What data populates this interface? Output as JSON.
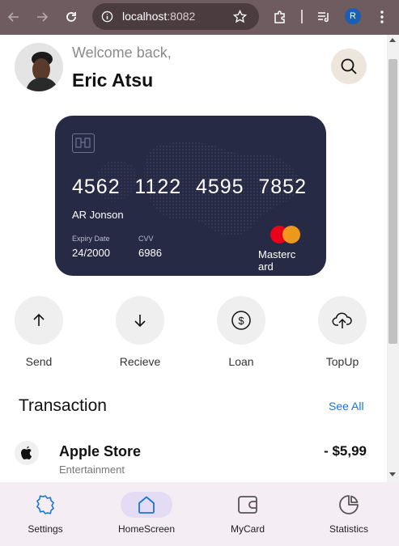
{
  "browser": {
    "url_host": "localhost",
    "url_port": ":8082",
    "profile_initial": "R"
  },
  "header": {
    "welcome": "Welcome back,",
    "user_name": "Eric Atsu"
  },
  "card": {
    "number_groups": [
      "4562",
      "1122",
      "4595",
      "7852"
    ],
    "holder": "AR Jonson",
    "expiry_label": "Expiry Date",
    "expiry_value": "24/2000",
    "cvv_label": "CVV",
    "cvv_value": "6986",
    "brand_lines": [
      "Masterc",
      "ard"
    ],
    "colors": {
      "background": "#262a45",
      "mc_red": "#eb001b",
      "mc_yellow": "#f79e1b"
    }
  },
  "actions": [
    {
      "label": "Send",
      "icon": "arrow-up-icon"
    },
    {
      "label": "Recieve",
      "icon": "arrow-down-icon"
    },
    {
      "label": "Loan",
      "icon": "dollar-circle-icon"
    },
    {
      "label": "TopUp",
      "icon": "cloud-upload-icon"
    }
  ],
  "transactions": {
    "title": "Transaction",
    "see_all": "See All",
    "items": [
      {
        "name": "Apple Store",
        "category": "Entertainment",
        "amount": "- $5,99",
        "icon": "apple-icon"
      }
    ]
  },
  "bottom_nav": {
    "items": [
      {
        "label": "Settings",
        "icon": "settings-icon",
        "active": false
      },
      {
        "label": "HomeScreen",
        "icon": "home-icon",
        "active": true
      },
      {
        "label": "MyCard",
        "icon": "wallet-icon",
        "active": false
      },
      {
        "label": "Statistics",
        "icon": "pie-chart-icon",
        "active": false
      }
    ],
    "accent": "#1976d2",
    "active_pill": "#e4dbf4"
  }
}
